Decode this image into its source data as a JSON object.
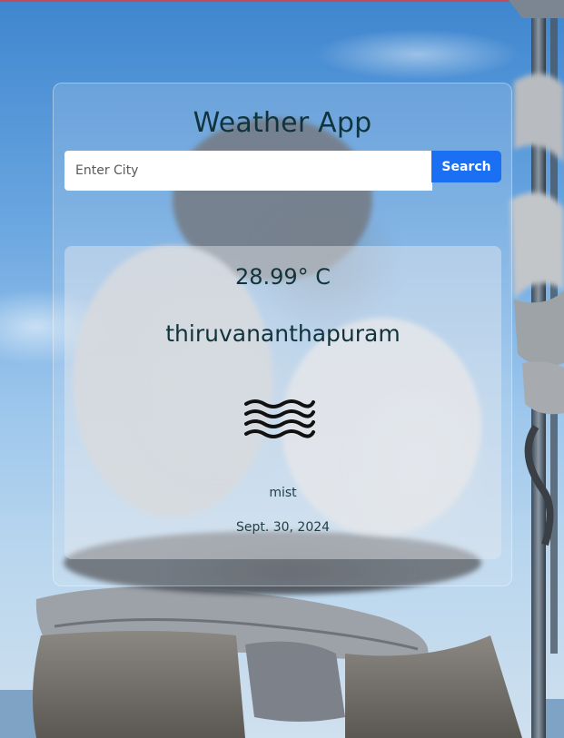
{
  "app": {
    "title": "Weather App"
  },
  "search": {
    "placeholder": "Enter City",
    "value": "",
    "button_label": "Search"
  },
  "weather": {
    "temperature": "28.99° C",
    "city": "thiruvananthapuram",
    "icon": "mist-icon",
    "description": "mist",
    "date": "Sept. 30, 2024"
  },
  "colors": {
    "accent": "#1a6ff2",
    "title_text": "#11343c"
  }
}
